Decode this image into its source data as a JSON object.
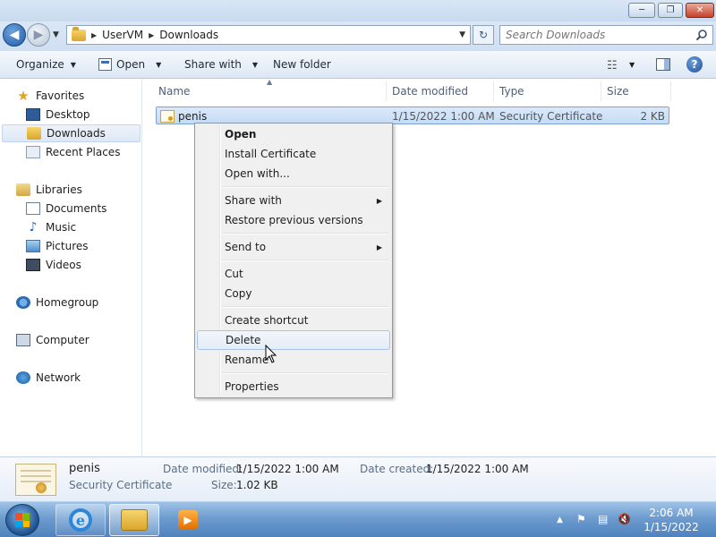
{
  "window": {
    "minimize_label": "─",
    "maximize_label": "❐",
    "close_label": "✕"
  },
  "nav": {
    "back_icon": "◀",
    "forward_icon": "▶",
    "dropdown_icon": "▼",
    "refresh_icon": "↻"
  },
  "address": {
    "segments": [
      "UserVM",
      "Downloads"
    ],
    "separator": "▶"
  },
  "search": {
    "placeholder": "Search Downloads"
  },
  "toolbar": {
    "organize": "Organize",
    "open": "Open",
    "share_with": "Share with",
    "new_folder": "New folder",
    "dropdown_arrow": "▼",
    "view_icon": "☷",
    "help_label": "?"
  },
  "sidebar": {
    "favorites": "Favorites",
    "desktop": "Desktop",
    "downloads": "Downloads",
    "recent_places": "Recent Places",
    "libraries": "Libraries",
    "documents": "Documents",
    "music": "Music",
    "pictures": "Pictures",
    "videos": "Videos",
    "homegroup": "Homegroup",
    "computer": "Computer",
    "network": "Network",
    "star_icon": "★",
    "music_icon": "♪"
  },
  "columns": {
    "name": "Name",
    "date_modified": "Date modified",
    "type": "Type",
    "size": "Size",
    "sort_caret": "▲"
  },
  "files": [
    {
      "name": "penis",
      "date_modified": "1/15/2022 1:00 AM",
      "type": "Security Certificate",
      "size": "2 KB"
    }
  ],
  "context_menu": {
    "items": [
      "Open",
      "Install Certificate",
      "Open with...",
      "Share with",
      "Restore previous versions",
      "Send to",
      "Cut",
      "Copy",
      "Create shortcut",
      "Delete",
      "Rename",
      "Properties"
    ],
    "submenu_arrow": "▶",
    "highlighted": "Delete"
  },
  "details": {
    "name": "penis",
    "type": "Security Certificate",
    "date_modified_label": "Date modified:",
    "date_modified": "1/15/2022 1:00 AM",
    "size_label": "Size:",
    "size": "1.02 KB",
    "date_created_label": "Date created:",
    "date_created": "1/15/2022 1:00 AM"
  },
  "taskbar": {
    "ie_letter": "e",
    "wmp_icon": "▶",
    "tray_show_hidden": "▲",
    "tray_flag": "⚑",
    "tray_network": "▤",
    "tray_volume": "🔇",
    "time": "2:06 AM",
    "date": "1/15/2022",
    "start_colors": [
      "#f25022",
      "#7fba00",
      "#00a4ef",
      "#ffb900"
    ]
  }
}
